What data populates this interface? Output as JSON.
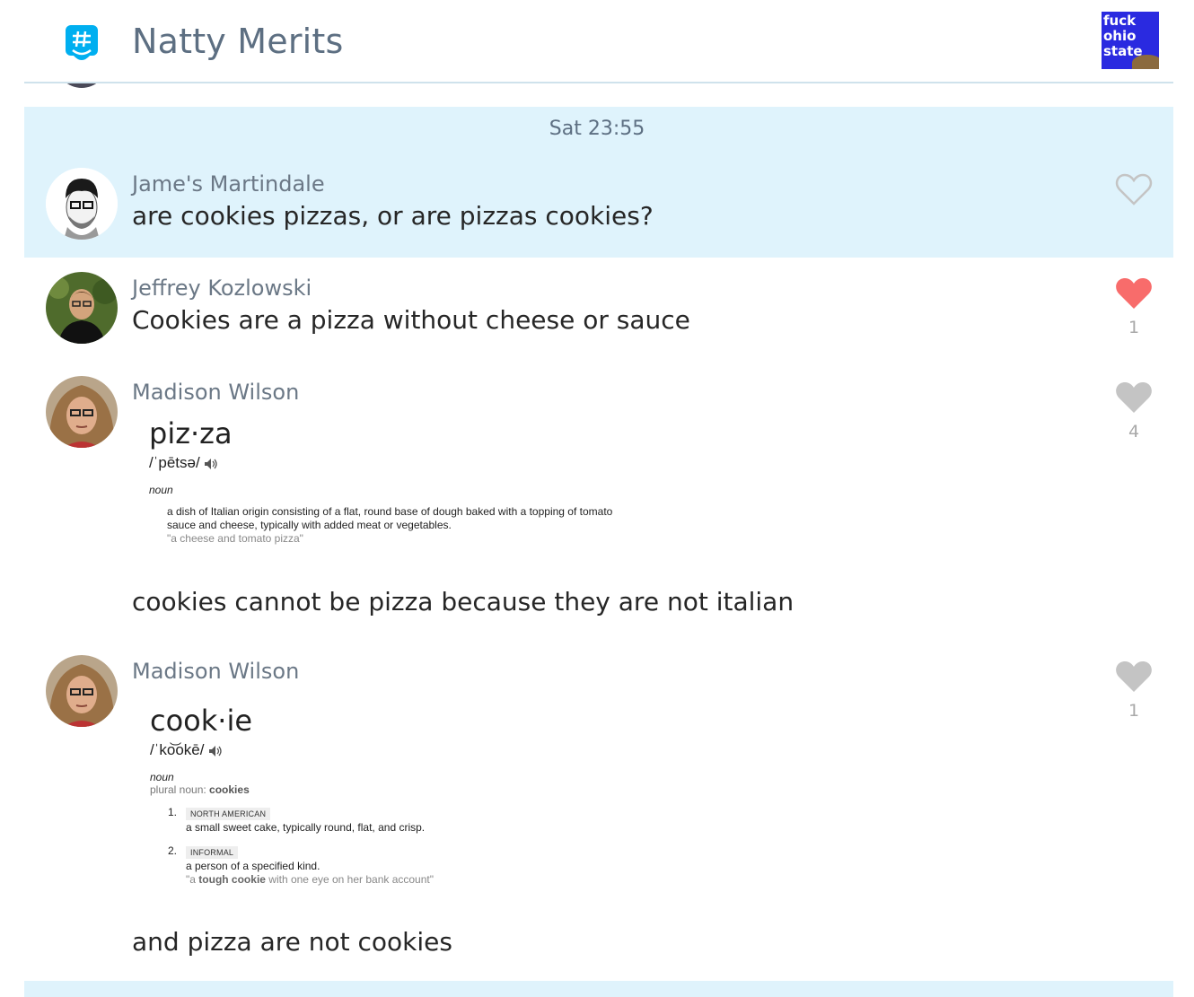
{
  "header": {
    "title": "Natty Merits",
    "group_avatar_text": "fuck\nohio\nstate"
  },
  "colors": {
    "accent": "#00aff0",
    "band": "#dff3fc",
    "liked_heart": "#f86c6b",
    "unliked_heart": "#c4c4c4"
  },
  "system": {
    "timestamp": "Sat 23:55"
  },
  "messages": [
    {
      "sender": "Jame's Martindale",
      "text": "are cookies pizzas, or are pizzas cookies?",
      "like_icon": "heart-outline-icon",
      "liked": false,
      "likes": ""
    },
    {
      "sender": "Jeffrey Kozlowski",
      "text": "Cookies are a pizza without cheese or sauce",
      "like_icon": "heart-filled-icon",
      "liked": true,
      "likes": "1"
    },
    {
      "sender": "Madison Wilson",
      "text": "cookies cannot be pizza because they are not italian",
      "like_icon": "heart-filled-icon",
      "liked": false,
      "likes": "4"
    },
    {
      "sender": "Madison Wilson",
      "text": "and pizza are not cookies",
      "like_icon": "heart-filled-icon",
      "liked": false,
      "likes": "1"
    }
  ],
  "pizza_def": {
    "word": "piz·za",
    "pron": "/ˈpētsə/",
    "pos": "noun",
    "def_line1": "a dish of Italian origin consisting of a flat, round base of dough baked with a topping of tomato",
    "def_line2": "sauce and cheese, typically with added meat or vegetables.",
    "example": "\"a cheese and tomato pizza\""
  },
  "cookie_def": {
    "word": "cook·ie",
    "pron": "/ˈko͝okē/",
    "pos": "noun",
    "plural_label": "plural noun: ",
    "plural_word": "cookies",
    "senses": [
      {
        "num": "1.",
        "tag": "NORTH AMERICAN",
        "def": "a small sweet cake, typically round, flat, and crisp."
      },
      {
        "num": "2.",
        "tag": "INFORMAL",
        "def": "a person of a specified kind.",
        "ex_pre": "\"a ",
        "ex_bold": "tough cookie",
        "ex_post": " with one eye on her bank account\""
      }
    ]
  }
}
